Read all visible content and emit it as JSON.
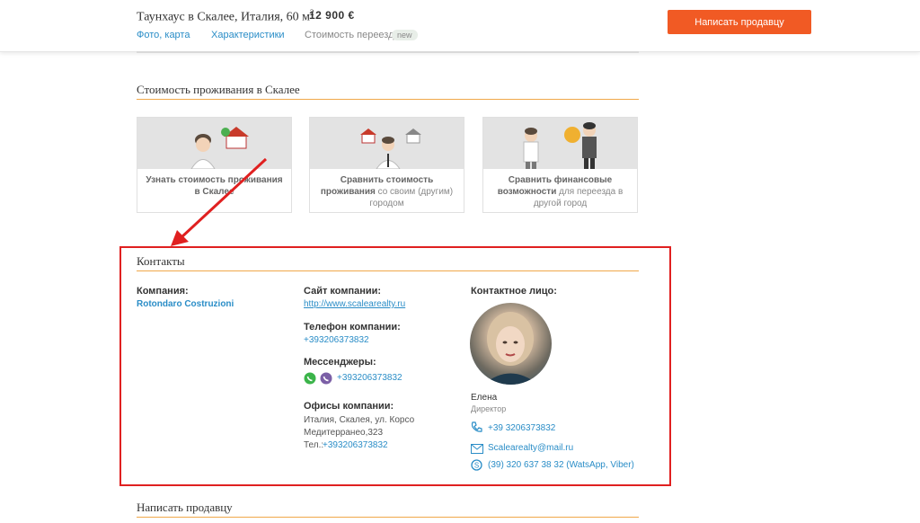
{
  "header": {
    "title": "Таунхаус в Скалее, Италия, 60 м",
    "title_sup": "2",
    "price": "12 900 €",
    "nav": [
      {
        "label": "Фото, карта"
      },
      {
        "label": "Характеристики"
      },
      {
        "label": "Стоимость переезда"
      }
    ],
    "new_badge": "new",
    "contact_button": "Написать продавцу"
  },
  "living_cost": {
    "title": "Стоимость проживания в Скалее",
    "cards": [
      {
        "bold": "Узнать стоимость проживания в Скалее",
        "rest": ""
      },
      {
        "bold": "Сравнить стоимость проживания",
        "rest": "со своим (другим) городом"
      },
      {
        "bold": "Сравнить финансовые возможности",
        "rest": "для переезда в другой город"
      }
    ]
  },
  "contacts": {
    "title": "Контакты",
    "company_label": "Компания:",
    "company_name": "Rotondaro Costruzioni",
    "site_label": "Сайт компании:",
    "site_url": "http://www.scalearealty.ru",
    "phone_label": "Телефон компании:",
    "phone": "+393206373832",
    "messengers_label": "Мессенджеры:",
    "messenger_phone": "+393206373832",
    "offices_label": "Офисы компании:",
    "office_line1": "Италия, Скалея, ул. Корсо",
    "office_line2": "Медитерранео,323",
    "office_tel_prefix": "Тел.:",
    "office_tel": "+393206373832",
    "contact_person_label": "Контактное лицо:",
    "person_name": "Елена",
    "person_role": "Директор",
    "person_phone": "+39 3206373832",
    "person_email": "Scalearealty@mail.ru",
    "person_other": "(39) 320 637 38 32 (WatsApp, Viber)"
  },
  "write_seller": {
    "title": "Написать продавцу"
  },
  "colors": {
    "accent_orange": "#f15a24",
    "link_blue": "#2a8dc7",
    "rule_orange": "#f0a84a",
    "highlight_red": "#e02020"
  }
}
